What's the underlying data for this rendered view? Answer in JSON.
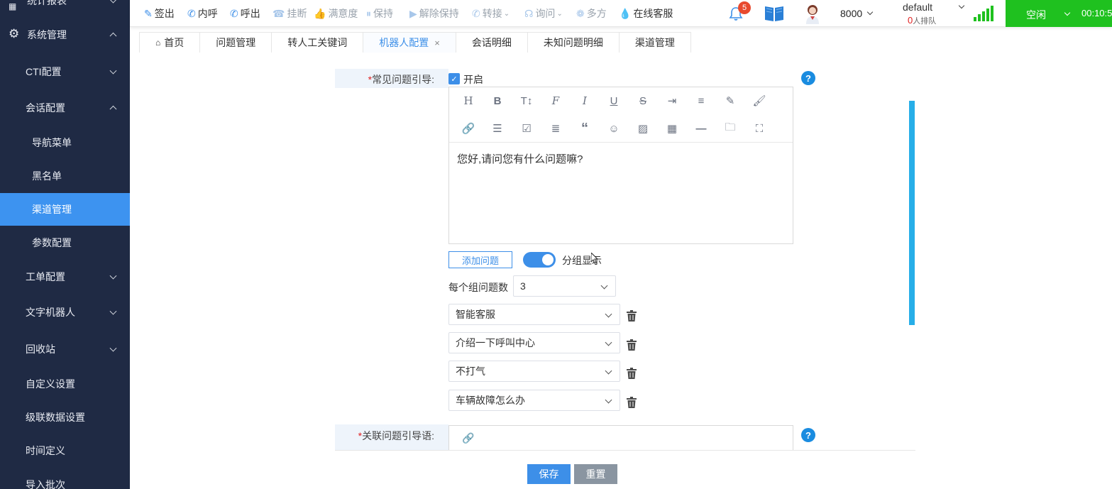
{
  "sidebar": {
    "top_partial": "统计报表",
    "items": [
      {
        "label": "系统管理",
        "expanded": true
      },
      {
        "label": "CTI配置"
      },
      {
        "label": "会话配置",
        "expanded": true
      },
      {
        "label": "导航菜单"
      },
      {
        "label": "黑名单"
      },
      {
        "label": "渠道管理",
        "active": true
      },
      {
        "label": "参数配置"
      },
      {
        "label": "工单配置"
      },
      {
        "label": "文字机器人"
      },
      {
        "label": "回收站"
      },
      {
        "label": "自定义设置"
      },
      {
        "label": "级联数据设置"
      },
      {
        "label": "时间定义"
      },
      {
        "label": "导入批次"
      }
    ]
  },
  "topbar": {
    "actions": [
      {
        "label": "签出",
        "icon": "pen-icon"
      },
      {
        "label": "内呼",
        "icon": "phone-icon"
      },
      {
        "label": "呼出",
        "icon": "phone-icon"
      },
      {
        "label": "挂断",
        "icon": "hangup-icon"
      },
      {
        "label": "满意度",
        "icon": "thumbs-up-icon"
      },
      {
        "label": "保持",
        "icon": "pause-icon"
      },
      {
        "label": "解除保持",
        "icon": "play-icon"
      },
      {
        "label": "转接",
        "icon": "transfer-icon"
      },
      {
        "label": "询问",
        "icon": "headset-icon"
      },
      {
        "label": "多方",
        "icon": "group-icon"
      },
      {
        "label": "在线客服",
        "icon": "drop-icon"
      }
    ],
    "notification_count": "5",
    "extension": "8000",
    "queue_name": "default",
    "queue_count": "0",
    "queue_suffix": "人排队",
    "status": "空闲",
    "timer": "00:10:5"
  },
  "tabs": [
    {
      "label": "首页"
    },
    {
      "label": "问题管理"
    },
    {
      "label": "转人工关键词"
    },
    {
      "label": "机器人配置",
      "active": true
    },
    {
      "label": "会话明细"
    },
    {
      "label": "未知问题明细"
    },
    {
      "label": "渠道管理"
    }
  ],
  "form": {
    "faq_label": "常见问题引导:",
    "enable_label": "开启",
    "editor_text": "您好,请问您有什么问题嘛?",
    "add_question": "添加问题",
    "group_display": "分组显示",
    "per_group_label": "每个组问题数",
    "per_group_value": "3",
    "questions": [
      "智能客服",
      "介绍一下呼叫中心",
      "不打气",
      "车辆故障怎么办"
    ],
    "related_label": "关联问题引导语:",
    "save": "保存",
    "reset": "重置"
  }
}
